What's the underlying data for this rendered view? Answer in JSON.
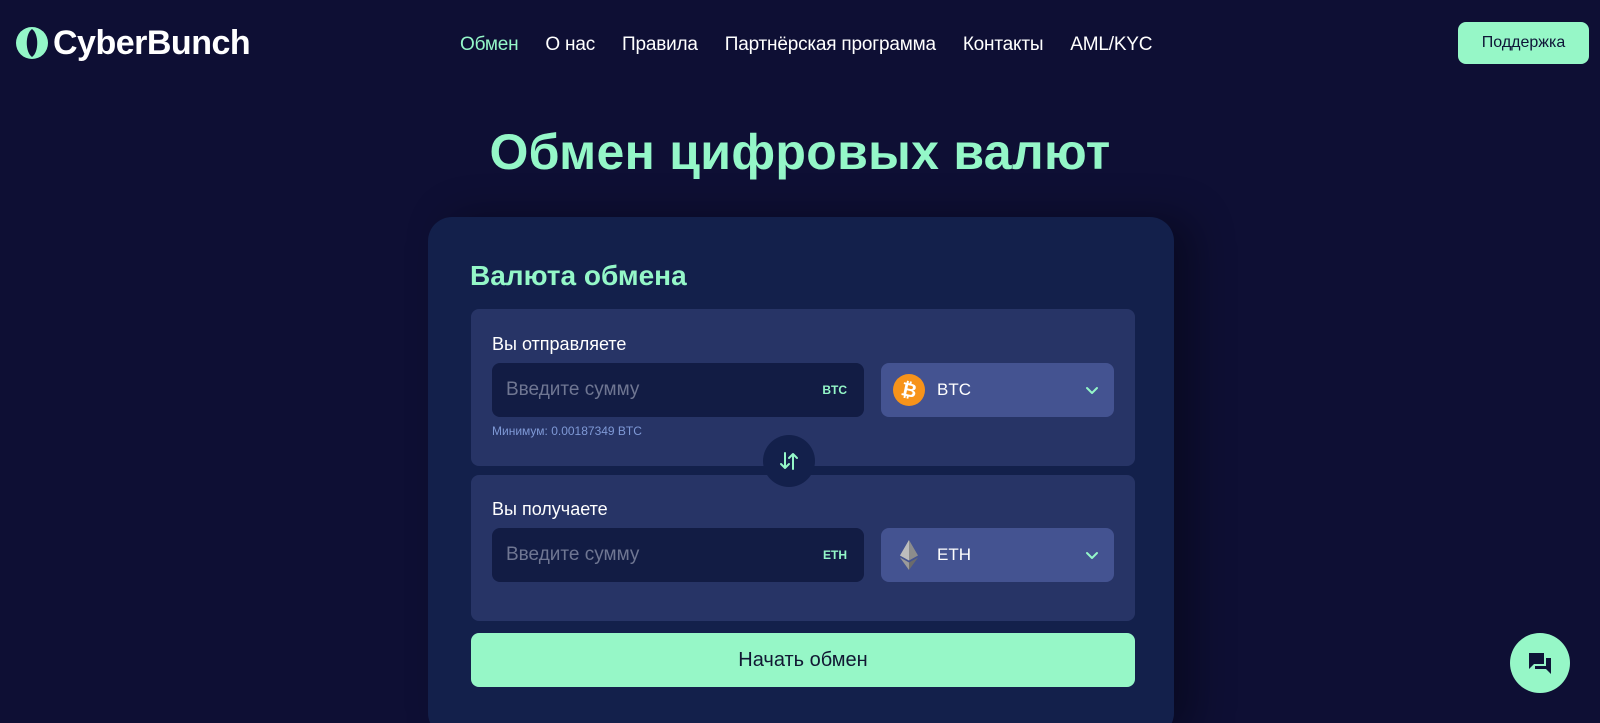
{
  "header": {
    "logo_text": "CyberBunch",
    "nav": [
      {
        "label": "Обмен",
        "active": true
      },
      {
        "label": "О нас",
        "active": false
      },
      {
        "label": "Правила",
        "active": false
      },
      {
        "label": "Партнёрская программа",
        "active": false
      },
      {
        "label": "Контакты",
        "active": false
      },
      {
        "label": "AML/KYC",
        "active": false
      }
    ],
    "support_label": "Поддержка"
  },
  "hero": {
    "title": "Обмен цифровых валют"
  },
  "exchange": {
    "title": "Валюта обмена",
    "send": {
      "label": "Вы отправляете",
      "amount_placeholder": "Введите сумму",
      "amount_value": "",
      "amount_code": "BTC",
      "currency": "BTC",
      "currency_icon": "bitcoin-icon",
      "min_hint": "Минимум: 0.00187349 BTC"
    },
    "receive": {
      "label": "Вы получаете",
      "amount_placeholder": "Введите сумму",
      "amount_value": "",
      "amount_code": "ETH",
      "currency": "ETH",
      "currency_icon": "ethereum-icon"
    },
    "swap_icon": "swap-arrows-icon",
    "start_label": "Начать обмен"
  },
  "chat": {
    "icon": "chat-icon"
  },
  "colors": {
    "background": "#0e0f34",
    "accent": "#94f7c8",
    "card": "#13204b",
    "panel": "#273466",
    "select": "#445391",
    "bitcoin": "#f7931a"
  }
}
